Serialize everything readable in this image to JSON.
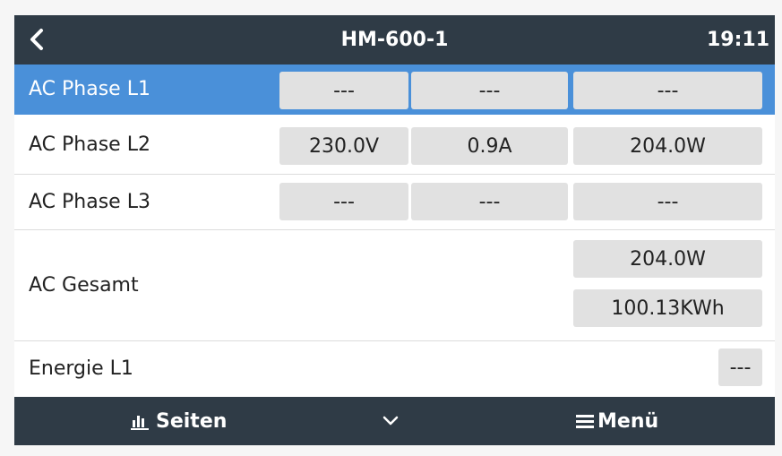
{
  "header": {
    "title": "HM-600-1",
    "time": "19:11",
    "back_icon": "chevron-left-icon"
  },
  "rows": [
    {
      "label": "AC Phase L1",
      "values": [
        "---",
        "---",
        "---"
      ],
      "selected": true
    },
    {
      "label": "AC Phase L2",
      "values": [
        "230.0V",
        "0.9A",
        "204.0W"
      ],
      "selected": false
    },
    {
      "label": "AC Phase L3",
      "values": [
        "---",
        "---",
        "---"
      ],
      "selected": false
    }
  ],
  "total": {
    "label": "AC Gesamt",
    "power": "204.0W",
    "energy": "100.13KWh"
  },
  "energy_l1": {
    "label": "Energie L1",
    "value": "---"
  },
  "footer": {
    "pages_label": "Seiten",
    "menu_label": "Menü",
    "pages_icon": "bar-chart-icon",
    "expand_icon": "chevron-down-icon",
    "menu_icon": "hamburger-icon"
  },
  "colors": {
    "header_bg": "#2f3b46",
    "selected_bg": "#4a90d9",
    "cell_bg": "#e1e1e1"
  }
}
